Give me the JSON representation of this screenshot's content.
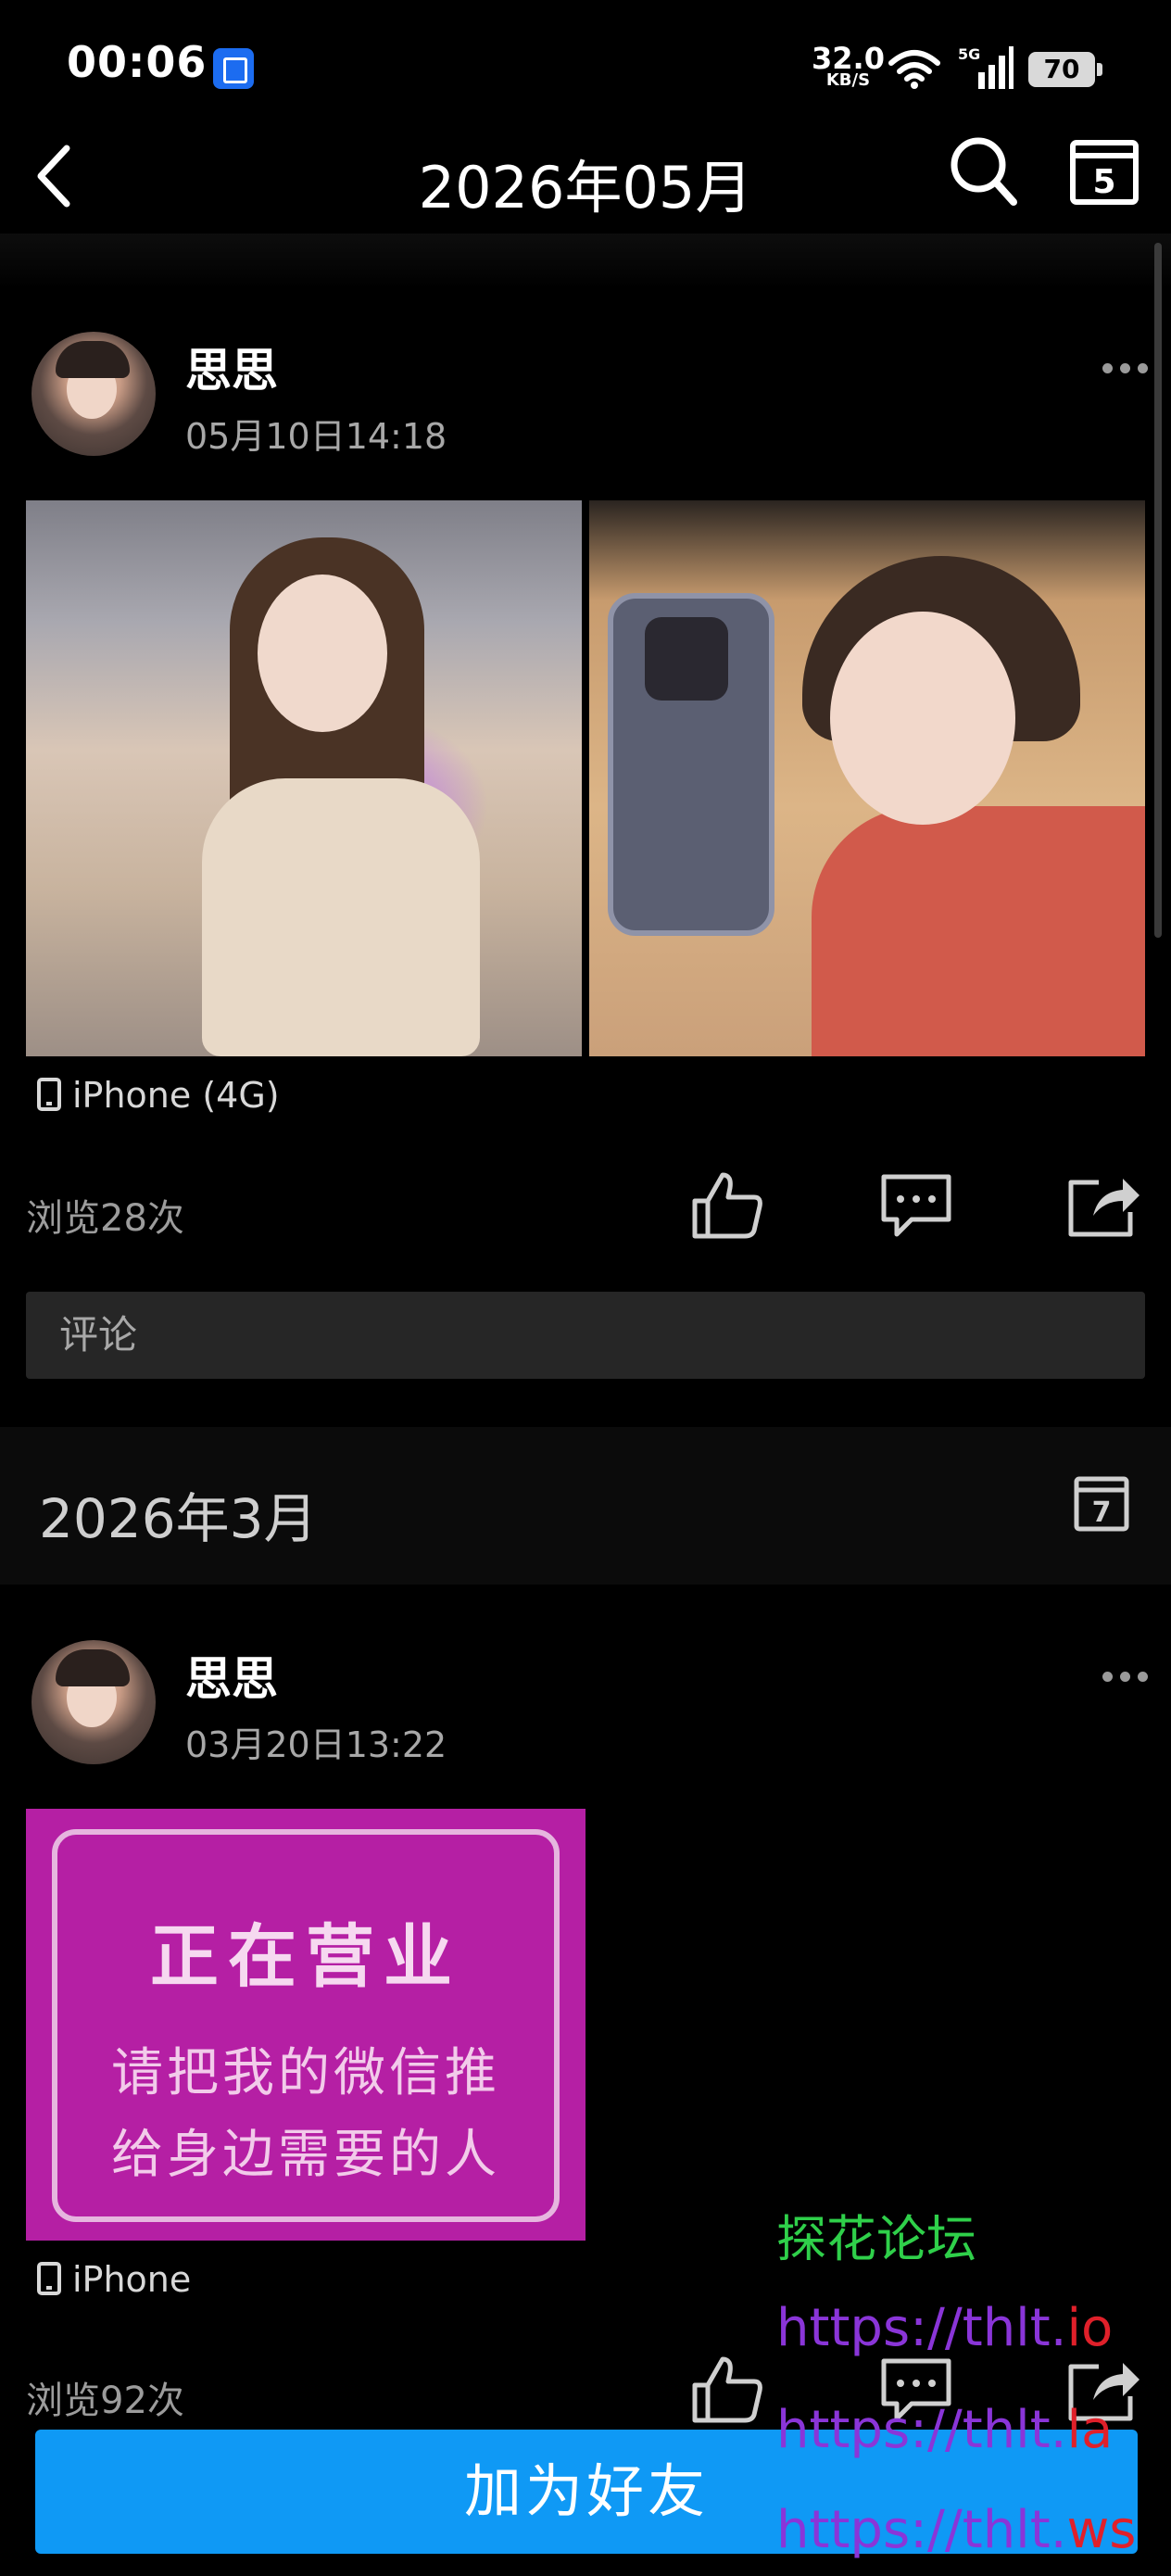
{
  "status_bar": {
    "time": "00:06",
    "net_speed": "32.0",
    "net_unit": "KB/S",
    "network_type": "5G",
    "battery": "70"
  },
  "nav": {
    "title": "2026年05月",
    "back_icon": "chevron-left-icon",
    "search_icon": "search-icon",
    "calendar_icon": "calendar-icon",
    "calendar_day": "5"
  },
  "posts": [
    {
      "author": "思思",
      "time": "05月10日14:18",
      "device": "iPhone (4G)",
      "views": "浏览28次",
      "comment_placeholder": "评论"
    },
    {
      "author": "思思",
      "time": "03月20日13:22",
      "image_text": [
        "正在营业",
        "请把我的微信推",
        "给身边需要的人"
      ],
      "device": "iPhone",
      "views": "浏览92次"
    }
  ],
  "month_divider": {
    "title": "2026年3月",
    "calendar_day": "7"
  },
  "bottom": {
    "add_friend_label": "加为好友"
  },
  "watermark": {
    "forum": "探花论坛",
    "url_prefix": "https://thlt.",
    "urls_suffix": [
      "io",
      "la",
      "ws"
    ]
  },
  "colors": {
    "accent": "#0f99f5",
    "background": "#000000",
    "comment_box": "#262626",
    "watermark_green": "#2fd04a",
    "watermark_purple": "#8a35d8",
    "watermark_red": "#e0202a"
  }
}
